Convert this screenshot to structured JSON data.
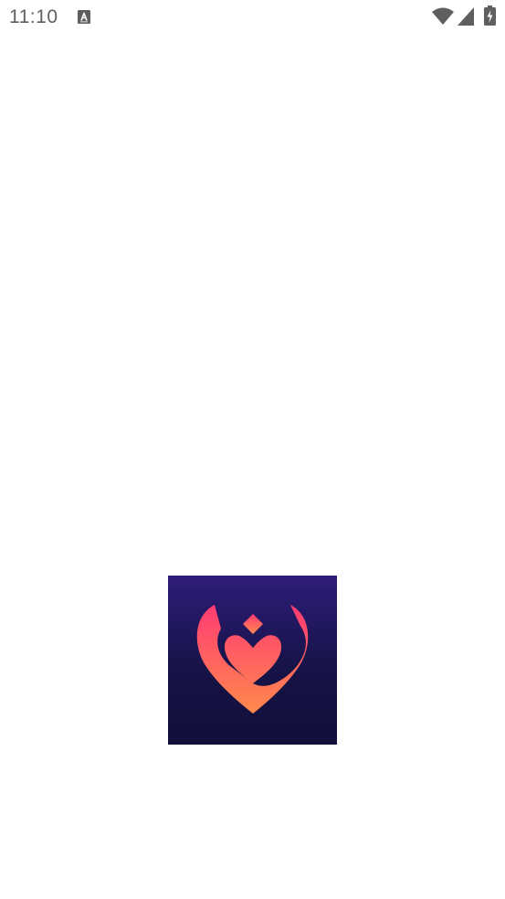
{
  "status_bar": {
    "time": "11:10",
    "notification_icon": "text-a-icon",
    "wifi_icon": "wifi-icon",
    "signal_icon": "cellular-signal-icon",
    "battery_icon": "battery-charging-icon",
    "icon_color": "#5f5f5f"
  },
  "splash": {
    "logo_icon": "heart-v-logo-icon",
    "background_top_color": "#2e1d7a",
    "background_bottom_color": "#120f3a",
    "mark_top_color": "#ff3b73",
    "mark_bottom_color": "#ff8a4c"
  }
}
